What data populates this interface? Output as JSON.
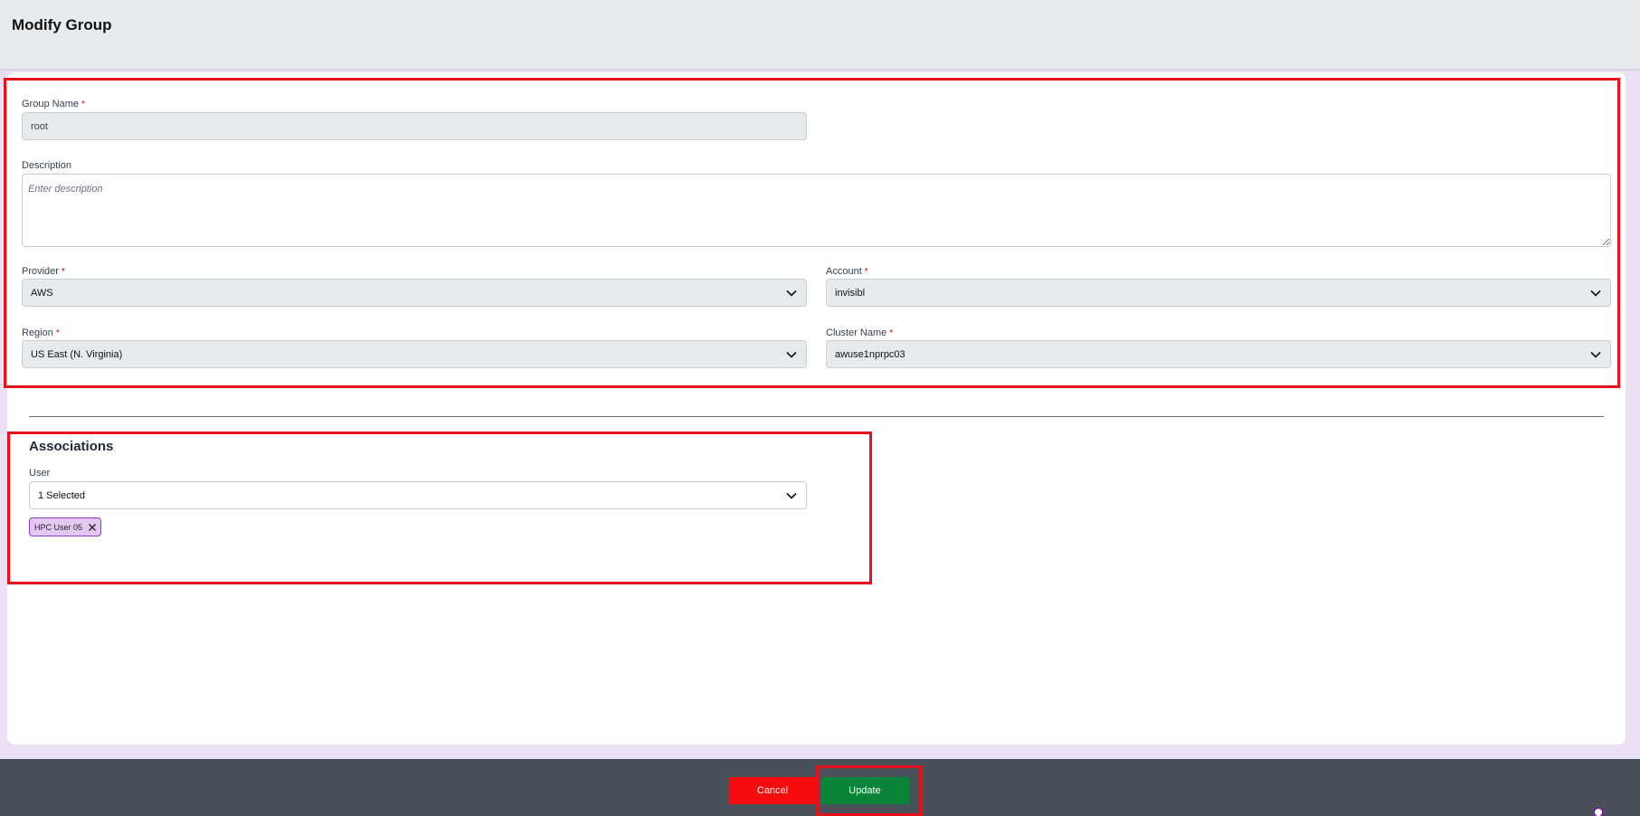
{
  "header": {
    "title": "Modify Group"
  },
  "form": {
    "group_name": {
      "label": "Group Name",
      "required": "*",
      "value": "root"
    },
    "description": {
      "label": "Description",
      "placeholder": "Enter description"
    },
    "provider": {
      "label": "Provider",
      "required": "*",
      "value": "AWS"
    },
    "account": {
      "label": "Account",
      "required": "*",
      "value": "invisibl"
    },
    "region": {
      "label": "Region",
      "required": "*",
      "value": "US East (N. Virginia)"
    },
    "cluster_name": {
      "label": "Cluster Name",
      "required": "*",
      "value": "awuse1nprpc03"
    }
  },
  "associations": {
    "title": "Associations",
    "user": {
      "label": "User",
      "value": "1 Selected",
      "chips": [
        "HPC User 05"
      ]
    }
  },
  "footer": {
    "cancel_label": "Cancel",
    "update_label": "Update"
  },
  "icons": {
    "dropdown": "chevron-down-icon",
    "remove": "close-icon"
  },
  "colors": {
    "highlight": "#e8101a",
    "cancel": "#f70d0d",
    "update": "#088538",
    "chip_bg": "#e2c8f2",
    "chip_border": "#8e3bc9",
    "footer_bg": "#4a5059"
  }
}
